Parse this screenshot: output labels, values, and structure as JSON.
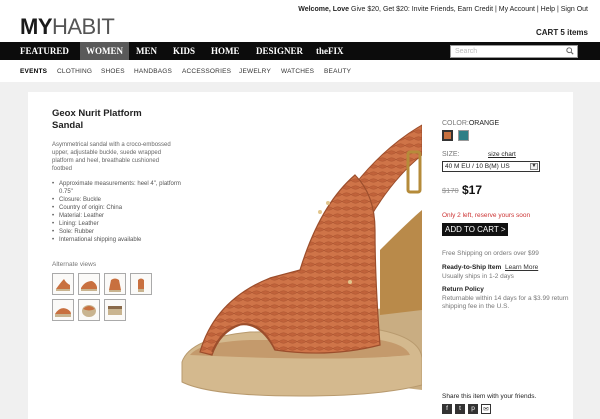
{
  "logo": {
    "bold": "MY",
    "light": "HABIT"
  },
  "util": {
    "welcome": "Welcome, Love",
    "links": "Give $20, Get $20: Invite Friends, Earn Credit | My Account | Help | Sign Out"
  },
  "cart": {
    "label": "CART 5 items"
  },
  "nav": {
    "items": [
      "FEATURED",
      "WOMEN",
      "MEN",
      "KIDS",
      "HOME",
      "DESIGNER",
      "theFIX"
    ],
    "active": "WOMEN"
  },
  "search": {
    "placeholder": "Search"
  },
  "subnav": {
    "items": [
      "EVENTS",
      "CLOTHING",
      "SHOES",
      "HANDBAGS",
      "ACCESSORIES",
      "JEWELRY",
      "WATCHES",
      "BEAUTY"
    ],
    "active": "EVENTS"
  },
  "product": {
    "title": "Geox Nurit Platform Sandal",
    "description": "Asymmetrical sandal with a croco-embossed upper, adjustable buckle, suede wrapped platform and heel, breathable cushioned footbed",
    "bullets": [
      "Approximate measurements: heel 4\", platform 0.75\"",
      "Closure: Buckle",
      "Country of origin: China",
      "Material: Leather",
      "Lining: Leather",
      "Sole: Rubber",
      "International shipping available"
    ],
    "alt_label": "Alternate views"
  },
  "colors": {
    "label": "COLOR:",
    "selected": "ORANGE",
    "swatches": [
      "#c8703f",
      "#2f7f86"
    ]
  },
  "size": {
    "label": "SIZE:",
    "chart_link": "size chart",
    "selected": "40 M EU / 10 B(M) US",
    "arrow": "▼"
  },
  "price": {
    "old": "$170",
    "new": "$17"
  },
  "stock": "Only 2 left, reserve yours soon",
  "add_to_cart": "ADD TO CART >",
  "shipping": "Free Shipping on orders over $99",
  "ready": {
    "title": "Ready-to-Ship Item",
    "link": "Learn More",
    "sub": "Usually ships in 1-2 days"
  },
  "returns": {
    "title": "Return Policy",
    "text": "Returnable within 14 days for a $3.99 return shipping fee in the U.S."
  },
  "share": {
    "label": "Share this item with your friends.",
    "icons": [
      {
        "name": "facebook-icon",
        "glyph": "f"
      },
      {
        "name": "twitter-icon",
        "glyph": "t"
      },
      {
        "name": "pinterest-icon",
        "glyph": "p"
      },
      {
        "name": "email-icon",
        "glyph": "✉"
      }
    ]
  },
  "palette": {
    "accent": "#c8703f",
    "stock": "#cc3333",
    "nav_bg": "#0c0c0c"
  }
}
